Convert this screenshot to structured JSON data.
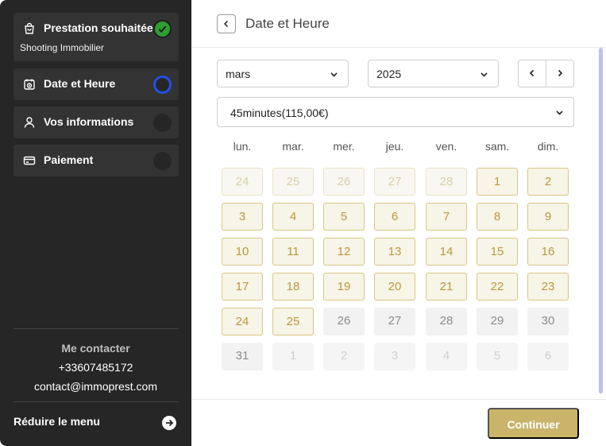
{
  "sidebar": {
    "steps": [
      {
        "label": "Prestation souhaitée",
        "sub": "Shooting Immobilier",
        "status": "done",
        "icon": "shopping-bag-icon"
      },
      {
        "label": "Date et Heure",
        "status": "current",
        "icon": "calendar-clock-icon"
      },
      {
        "label": "Vos informations",
        "status": "todo",
        "icon": "user-icon"
      },
      {
        "label": "Paiement",
        "status": "todo",
        "icon": "credit-card-icon"
      }
    ],
    "contact": {
      "title": "Me contacter",
      "phone": "+33607485172",
      "email": "contact@immoprest.com"
    },
    "reduce_label": "Réduire le menu"
  },
  "header": {
    "title": "Date et Heure"
  },
  "filters": {
    "month": "mars",
    "year": "2025",
    "service": "45minutes(115,00€)"
  },
  "calendar": {
    "weekdays": [
      "lun.",
      "mar.",
      "mer.",
      "jeu.",
      "ven.",
      "sam.",
      "dim."
    ],
    "days": [
      {
        "label": "24",
        "state": "faded"
      },
      {
        "label": "25",
        "state": "faded"
      },
      {
        "label": "26",
        "state": "faded"
      },
      {
        "label": "27",
        "state": "faded"
      },
      {
        "label": "28",
        "state": "faded"
      },
      {
        "label": "1",
        "state": "avail"
      },
      {
        "label": "2",
        "state": "avail"
      },
      {
        "label": "3",
        "state": "avail"
      },
      {
        "label": "4",
        "state": "avail"
      },
      {
        "label": "5",
        "state": "avail"
      },
      {
        "label": "6",
        "state": "avail"
      },
      {
        "label": "7",
        "state": "avail"
      },
      {
        "label": "8",
        "state": "avail"
      },
      {
        "label": "9",
        "state": "avail"
      },
      {
        "label": "10",
        "state": "avail"
      },
      {
        "label": "11",
        "state": "avail"
      },
      {
        "label": "12",
        "state": "avail"
      },
      {
        "label": "13",
        "state": "avail"
      },
      {
        "label": "14",
        "state": "avail"
      },
      {
        "label": "15",
        "state": "avail"
      },
      {
        "label": "16",
        "state": "avail"
      },
      {
        "label": "17",
        "state": "avail"
      },
      {
        "label": "18",
        "state": "avail"
      },
      {
        "label": "19",
        "state": "avail"
      },
      {
        "label": "20",
        "state": "avail"
      },
      {
        "label": "21",
        "state": "avail"
      },
      {
        "label": "22",
        "state": "avail"
      },
      {
        "label": "23",
        "state": "avail"
      },
      {
        "label": "24",
        "state": "avail"
      },
      {
        "label": "25",
        "state": "avail"
      },
      {
        "label": "26",
        "state": "unavail"
      },
      {
        "label": "27",
        "state": "unavail"
      },
      {
        "label": "28",
        "state": "unavail"
      },
      {
        "label": "29",
        "state": "unavail"
      },
      {
        "label": "30",
        "state": "unavail"
      },
      {
        "label": "31",
        "state": "unavail"
      },
      {
        "label": "1",
        "state": "unavail-faded"
      },
      {
        "label": "2",
        "state": "unavail-faded"
      },
      {
        "label": "3",
        "state": "unavail-faded"
      },
      {
        "label": "4",
        "state": "unavail-faded"
      },
      {
        "label": "5",
        "state": "unavail-faded"
      },
      {
        "label": "6",
        "state": "unavail-faded"
      }
    ]
  },
  "footer": {
    "continue_label": "Continuer"
  },
  "colors": {
    "accent": "#c9b46a",
    "done": "#2e9e32",
    "current": "#2250e6",
    "sidebar_bg": "#262626"
  }
}
